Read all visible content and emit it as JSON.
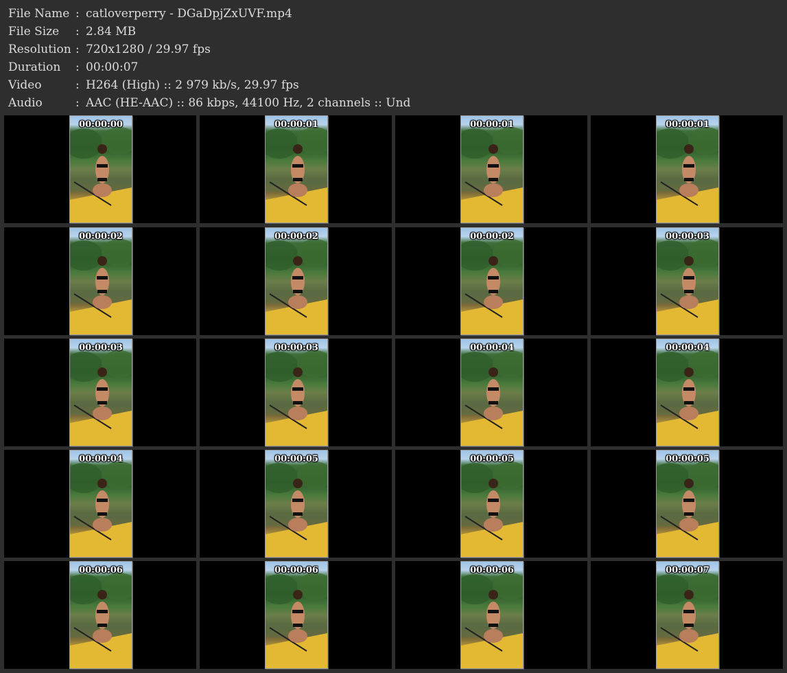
{
  "file_info": [
    {
      "label": "File Name",
      "sep": ":",
      "value": "catloverperry - DGaDpjZxUVF.mp4"
    },
    {
      "label": "File Size",
      "sep": ":",
      "value": "2.84 MB"
    },
    {
      "label": "Resolution",
      "sep": ":",
      "value": "720x1280 / 29.97 fps"
    },
    {
      "label": "Duration",
      "sep": ":",
      "value": "00:00:07"
    },
    {
      "label": "Video",
      "sep": ":",
      "value": "H264 (High) :: 2 979 kb/s, 29.97 fps"
    },
    {
      "label": "Audio",
      "sep": ":",
      "value": "AAC (HE-AAC) :: 86 kbps, 44100 Hz, 2 channels :: Und"
    }
  ],
  "thumbnails": [
    "00:00:00",
    "00:00:01",
    "00:00:01",
    "00:00:01",
    "00:00:02",
    "00:00:02",
    "00:00:02",
    "00:00:03",
    "00:00:03",
    "00:00:03",
    "00:00:04",
    "00:00:04",
    "00:00:04",
    "00:00:05",
    "00:00:05",
    "00:00:05",
    "00:00:06",
    "00:00:06",
    "00:00:06",
    "00:00:07"
  ],
  "colors": {
    "background": "#2e2e2e",
    "cell_background": "#000000",
    "text": "#dcdcdc"
  }
}
